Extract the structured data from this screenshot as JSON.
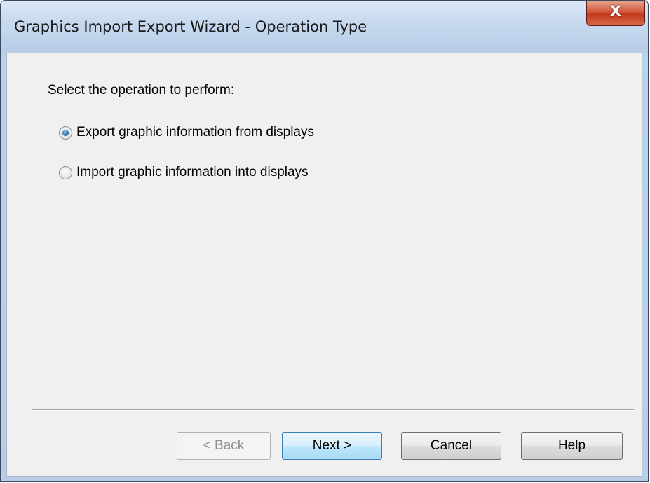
{
  "window": {
    "title": "Graphics Import Export Wizard - Operation Type",
    "close_label": "X"
  },
  "content": {
    "prompt": "Select the operation to perform:",
    "options": [
      {
        "label": "Export graphic information from displays",
        "checked": true
      },
      {
        "label": "Import graphic information into displays",
        "checked": false
      }
    ]
  },
  "buttons": {
    "back": {
      "label": "< Back",
      "enabled": false
    },
    "next": {
      "label": "Next >",
      "enabled": true,
      "default": true
    },
    "cancel": {
      "label": "Cancel",
      "enabled": true
    },
    "help": {
      "label": "Help",
      "enabled": true
    }
  },
  "colors": {
    "title_bar": "#c5d8ee",
    "close_button": "#c23a1e",
    "dialog_face": "#f0f0f0",
    "default_button": "#bee6fd"
  }
}
